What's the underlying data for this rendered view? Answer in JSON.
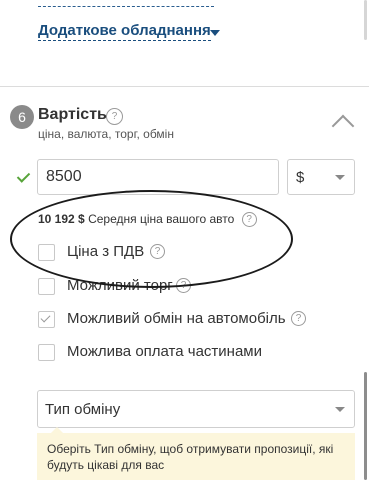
{
  "extra_equipment": {
    "label": "Додаткове обладнання"
  },
  "cost_section": {
    "step_number": "6",
    "title": "Вартість",
    "subtitle": "ціна, валюта, торг, обмін",
    "price_value": "8500",
    "currency": "$",
    "average_price": {
      "amount": "10 192 $",
      "label": "Середня ціна вашого авто"
    },
    "options": [
      {
        "label": "Ціна з ПДВ",
        "checked": false,
        "has_help": true
      },
      {
        "label": "Можливий торг",
        "checked": false,
        "has_help": true
      },
      {
        "label": "Можливий обмін на автомобіль",
        "checked": true,
        "has_help": true
      },
      {
        "label": "Можлива оплата частинами",
        "checked": false,
        "has_help": false
      }
    ],
    "exchange_type": {
      "value": "Тип обміну"
    },
    "exchange_hint": "Оберіть Тип обміну, щоб отримувати пропозиції, які будуть цікаві для вас"
  },
  "icons": {
    "help": "?",
    "check": "check-icon",
    "chevron_up": "chevron-up-icon",
    "caret_down": "caret-down-icon"
  },
  "colors": {
    "link": "#1a4e7e",
    "valid_check": "#58a43a",
    "step_badge": "#8a8a8a",
    "hint_background": "#fcf6dc",
    "annotation": "#1b1b1b"
  }
}
